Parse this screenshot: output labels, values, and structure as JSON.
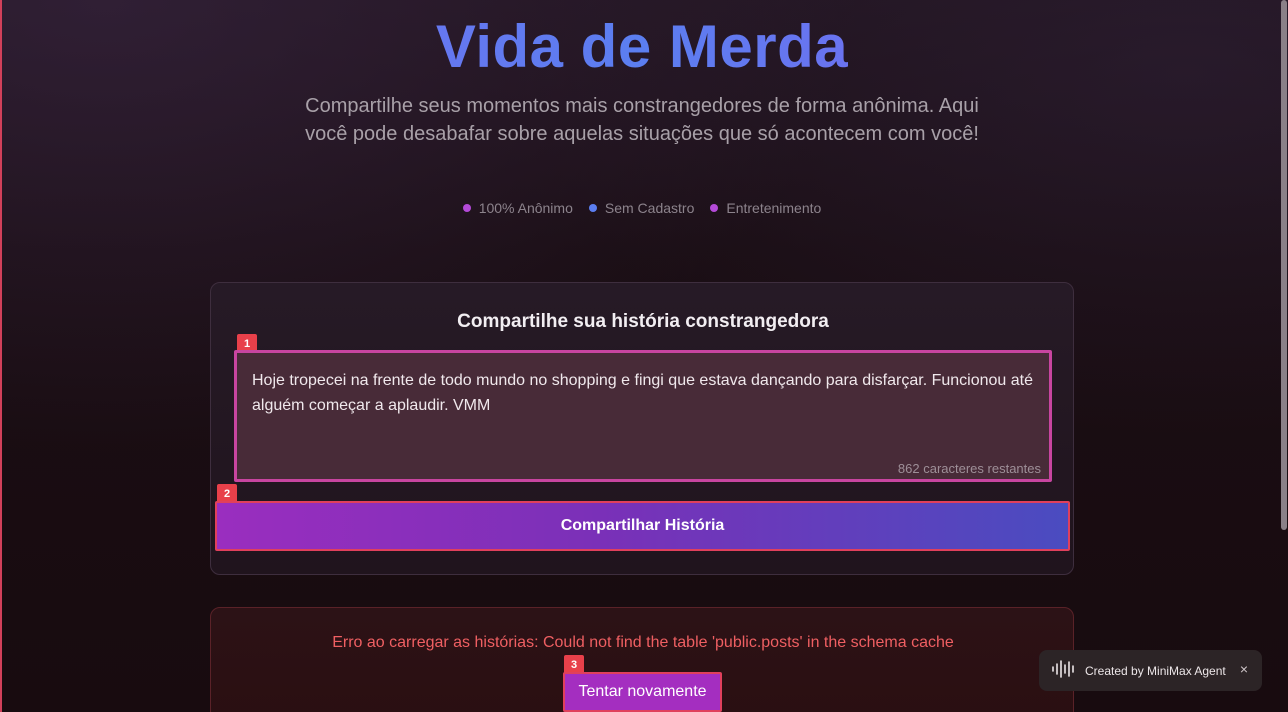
{
  "header": {
    "title": "Vida de Merda",
    "subtitle": "Compartilhe seus momentos mais constrangedores de forma anônima. Aqui você pode desabafar sobre aquelas situações que só acontecem com você!",
    "features": [
      {
        "label": "100% Anônimo",
        "dot_color": "#b44ad8"
      },
      {
        "label": "Sem Cadastro",
        "dot_color": "#5b7ef0"
      },
      {
        "label": "Entretenimento",
        "dot_color": "#b44ad8"
      }
    ]
  },
  "form": {
    "title": "Compartilhe sua história constrangedora",
    "story_text": "Hoje tropecei na frente de todo mundo no shopping e fingi que estava dançando para disfarçar. Funcionou até alguém começar a aplaudir. VMM",
    "counter": "862 caracteres restantes",
    "submit_label": "Compartilhar História",
    "badges": {
      "textarea": "1",
      "submit": "2"
    }
  },
  "error": {
    "message": "Erro ao carregar as histórias: Could not find the table 'public.posts' in the schema cache",
    "retry_label": "Tentar novamente",
    "badge": "3"
  },
  "minimax_widget": {
    "label": "Created by MiniMax Agent",
    "close": "×",
    "icon": "waveform-icon"
  },
  "colors": {
    "accent_purple": "#9a2ebf",
    "accent_blue": "#4a4cc0",
    "error_red": "#ef5f62",
    "highlight_border": "#e0405c"
  }
}
